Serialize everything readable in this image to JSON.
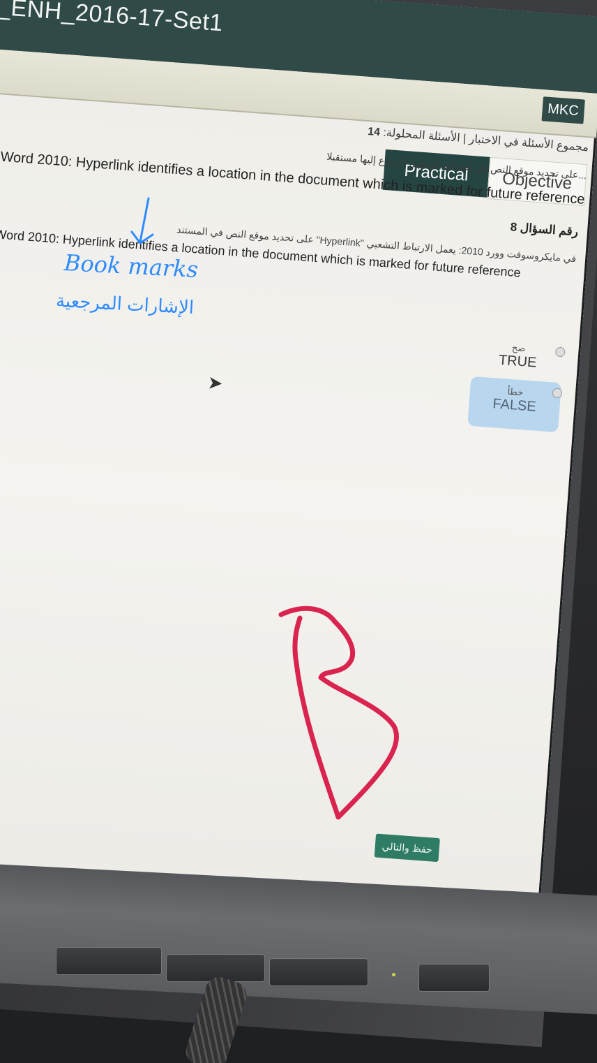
{
  "window": {
    "title": "_ENH_2016-17-Set1",
    "brand": "MKC"
  },
  "breadcrumb": {
    "all_questions": "مجموع الأسئلة في الاختبار",
    "answered_label": "الأسئلة المحلولة:",
    "answered_count": "14"
  },
  "tabs": {
    "practical": "Practical",
    "objective": "Objective"
  },
  "question": {
    "number_label": "رقم السؤال 8",
    "arabic_top": "...على تحديد موقع النص في المستند لتسهيل الرجوع إليها مستقبلا",
    "english_top": "Word 2010: Hyperlink identifies a location in the document which is marked for future reference",
    "arabic": "في مايكروسوفت وورد 2010: يعمل الارتباط التشعبي \"Hyperlink\" على تحديد موقع النص في المستند",
    "english": "Word 2010: Hyperlink identifies a location in the document which is marked for future reference"
  },
  "options": [
    {
      "ar": "صح",
      "en": "TRUE",
      "selected": false
    },
    {
      "ar": "خطأ",
      "en": "FALSE",
      "selected": true
    }
  ],
  "next_button": "حفظ والتالي",
  "annotations": {
    "bookmarks_en": "Book marks",
    "bookmarks_ar": "الإشارات المرجعية",
    "letter": "B",
    "pen_blue": "#2e8bff",
    "pen_red": "#d9244f"
  },
  "colors": {
    "titlebar": "#2f4a47",
    "tab_active": "#254543",
    "selected_option": "#b9d6ef",
    "next_button": "#2f7c66"
  }
}
